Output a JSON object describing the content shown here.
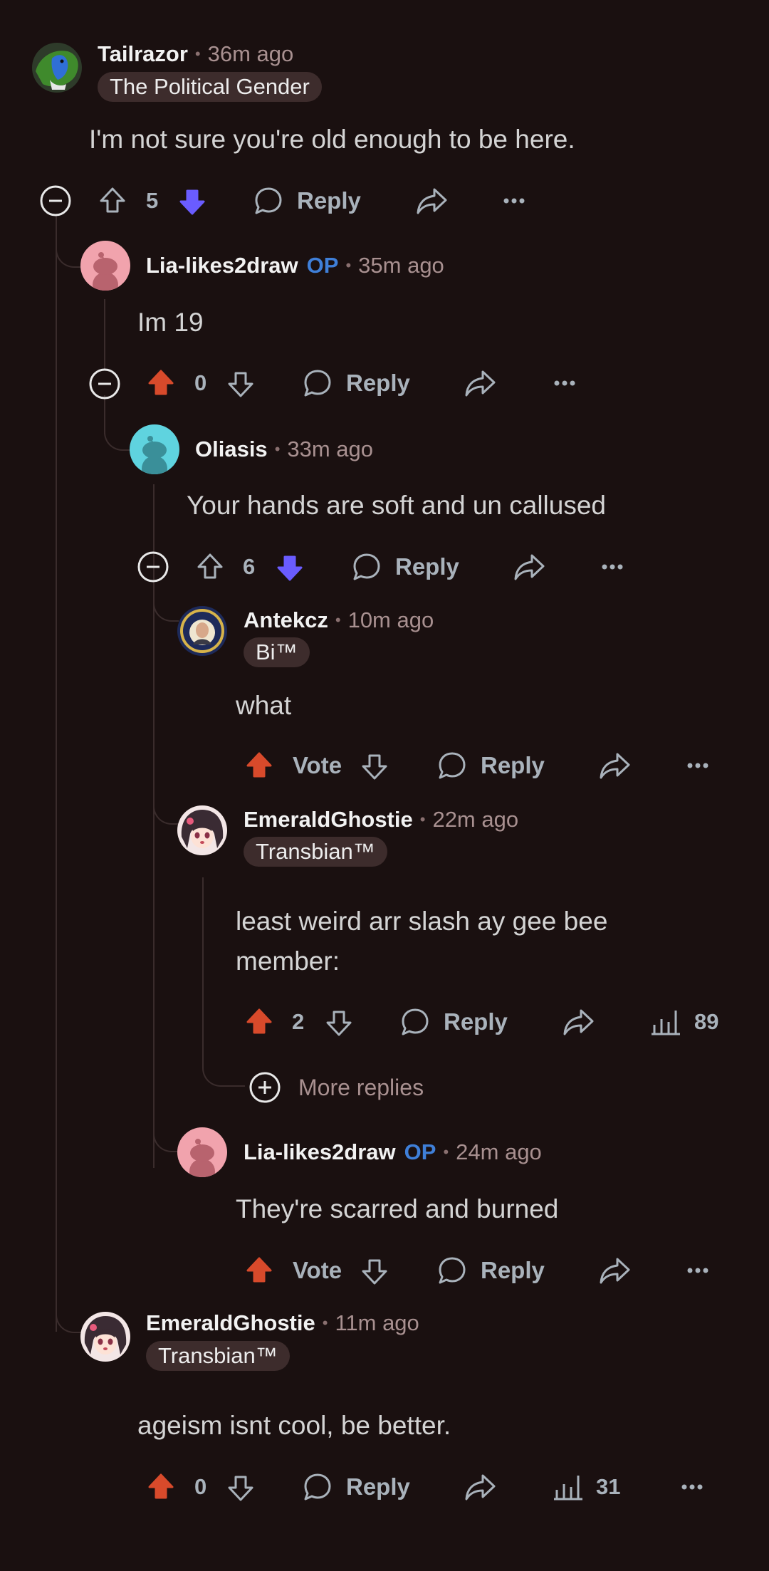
{
  "colors": {
    "background": "#1a1010",
    "upvote_active": "#d84a2b",
    "downvote_active": "#6a5cff",
    "op_badge": "#3f7fd8",
    "thread_line": "#3a2c2c",
    "flair_bg": "#3d2c2c"
  },
  "comments": [
    {
      "username": "Tailrazor",
      "time": "36m ago",
      "flair": "The Political Gender",
      "body": "I'm not sure you're old enough to be here.",
      "score": "5",
      "vote_state": "downvoted",
      "reply_label": "Reply",
      "avatar": "green-dragon-avatar"
    },
    {
      "username": "Lia-likes2draw",
      "op_badge": "OP",
      "time": "35m ago",
      "body": "Im 19",
      "score": "0",
      "vote_state": "upvoted",
      "reply_label": "Reply",
      "avatar": "pink-snoo-avatar"
    },
    {
      "username": "Oliasis",
      "time": "33m ago",
      "body": "Your hands are soft and un callused",
      "score": "6",
      "vote_state": "downvoted",
      "reply_label": "Reply",
      "avatar": "teal-snoo-avatar"
    },
    {
      "username": "Antekcz",
      "time": "10m ago",
      "flair": "Bi™",
      "body": "what",
      "score": "Vote",
      "vote_state": "upvoted",
      "reply_label": "Reply",
      "avatar": "seal-portrait-avatar"
    },
    {
      "username": "EmeraldGhostie",
      "time": "22m ago",
      "flair": "Transbian™",
      "body_lines": [
        "least weird arr slash ay gee bee",
        "member:"
      ],
      "score": "2",
      "vote_state": "upvoted",
      "reply_label": "Reply",
      "views": "89",
      "avatar": "anime-girl-avatar",
      "more_replies": "More replies"
    },
    {
      "username": "Lia-likes2draw",
      "op_badge": "OP",
      "time": "24m ago",
      "body": "They're scarred and burned",
      "score": "Vote",
      "vote_state": "upvoted",
      "reply_label": "Reply",
      "avatar": "pink-snoo-avatar"
    },
    {
      "username": "EmeraldGhostie",
      "time": "11m ago",
      "flair": "Transbian™",
      "body": "ageism isnt cool, be better.",
      "score": "0",
      "vote_state": "upvoted",
      "reply_label": "Reply",
      "views": "31",
      "avatar": "anime-girl-avatar"
    }
  ]
}
